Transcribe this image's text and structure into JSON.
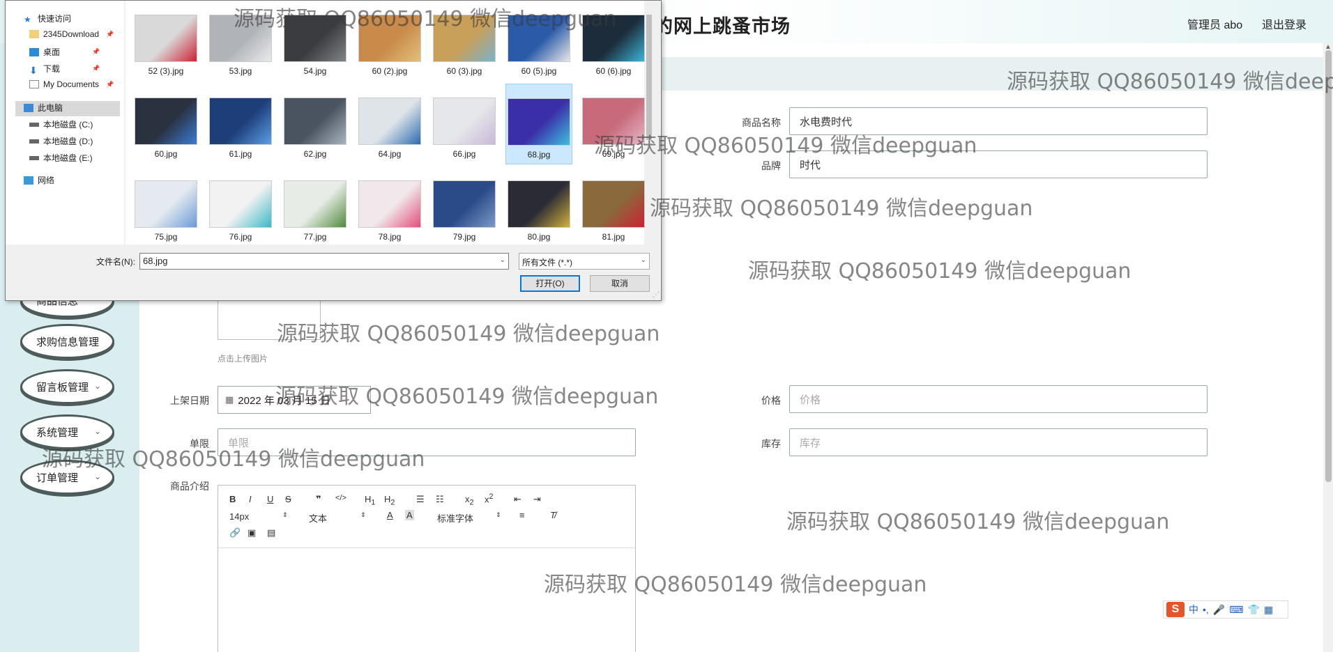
{
  "header": {
    "site_title": "的网上跳蚤市场",
    "admin_label": "管理员 abo",
    "logout_label": "退出登录"
  },
  "sidebar": {
    "items": [
      {
        "label": "商品信息",
        "has_chevron": false
      },
      {
        "label": "求购信息管理",
        "has_chevron": false
      },
      {
        "label": "留言板管理",
        "has_chevron": true
      },
      {
        "label": "系统管理",
        "has_chevron": true
      },
      {
        "label": "订单管理",
        "has_chevron": true
      }
    ]
  },
  "form": {
    "name_label": "商品名称",
    "name_value": "水电费时代",
    "brand_label": "品牌",
    "brand_value": "时代",
    "upload_hint": "点击上传图片",
    "date_label": "上架日期",
    "date_value": "2022 年 03 月 15 日",
    "price_label": "价格",
    "price_placeholder": "价格",
    "limit_label": "单限",
    "limit_placeholder": "单限",
    "stock_label": "库存",
    "stock_placeholder": "库存",
    "intro_label": "商品介绍"
  },
  "editor": {
    "font_size": "14px",
    "block_type": "文本",
    "font_family": "标准字体",
    "buttons": [
      "B",
      "I",
      "U",
      "S",
      "99",
      "</>",
      "H1",
      "H2",
      "list-ordered",
      "list-bullet",
      "x2-sub",
      "x2-sup",
      "outdent",
      "indent",
      "text-color",
      "bg-color",
      "align",
      "clear-format",
      "link",
      "image",
      "video"
    ]
  },
  "dialog": {
    "nav": [
      {
        "label": "快速访问",
        "icon": "star-icon",
        "pinned": false
      },
      {
        "label": "2345Download",
        "icon": "folder-icon",
        "pinned": true
      },
      {
        "label": "桌面",
        "icon": "desktop-icon",
        "pinned": true
      },
      {
        "label": "下载",
        "icon": "download-icon",
        "pinned": true
      },
      {
        "label": "My Documents",
        "icon": "document-icon",
        "pinned": true
      },
      {
        "label": "此电脑",
        "icon": "computer-icon",
        "pinned": false
      },
      {
        "label": "本地磁盘 (C:)",
        "icon": "drive-icon",
        "pinned": false
      },
      {
        "label": "本地磁盘 (D:)",
        "icon": "drive-icon",
        "pinned": false
      },
      {
        "label": "本地磁盘 (E:)",
        "icon": "drive-icon",
        "pinned": false
      },
      {
        "label": "网络",
        "icon": "network-icon",
        "pinned": false
      }
    ],
    "files": [
      {
        "name": "52 (3).jpg",
        "color": "#d9d9d9",
        "accent": "#c23"
      },
      {
        "name": "53.jpg",
        "color": "#b0b4b8",
        "accent": "#e9eaec"
      },
      {
        "name": "54.jpg",
        "color": "#3a3c40",
        "accent": "#808387"
      },
      {
        "name": "60 (2).jpg",
        "color": "#c98a4a",
        "accent": "#e2c07a"
      },
      {
        "name": "60 (3).jpg",
        "color": "#c9a05a",
        "accent": "#7ab3c9"
      },
      {
        "name": "60 (5).jpg",
        "color": "#2a5aa8",
        "accent": "#e8e8e8"
      },
      {
        "name": "60 (6).jpg",
        "color": "#1d2c3a",
        "accent": "#3ab6d8"
      },
      {
        "name": "60.jpg",
        "color": "#2a3240",
        "accent": "#3b7bd6"
      },
      {
        "name": "61.jpg",
        "color": "#1e3e7a",
        "accent": "#5aa0e8"
      },
      {
        "name": "62.jpg",
        "color": "#4a5460",
        "accent": "#a9b6c2"
      },
      {
        "name": "64.jpg",
        "color": "#dfe4e8",
        "accent": "#2e6bb0"
      },
      {
        "name": "66.jpg",
        "color": "#e6e7ea",
        "accent": "#c9b8d8"
      },
      {
        "name": "68.jpg",
        "color": "#3b2fa8",
        "accent": "#3cc0e0"
      },
      {
        "name": "69.jpg",
        "color": "#c86a7a",
        "accent": "#e3b8c8"
      },
      {
        "name": "75.jpg",
        "color": "#e4eaf0",
        "accent": "#6a9ad8"
      },
      {
        "name": "76.jpg",
        "color": "#f2f2f2",
        "accent": "#3ab8c8"
      },
      {
        "name": "77.jpg",
        "color": "#e8ece6",
        "accent": "#4f8a3c"
      },
      {
        "name": "78.jpg",
        "color": "#f0e8ea",
        "accent": "#e34e7a"
      },
      {
        "name": "79.jpg",
        "color": "#2a4a88",
        "accent": "#7a9ac8"
      },
      {
        "name": "80.jpg",
        "color": "#2b2b36",
        "accent": "#d4b13c"
      },
      {
        "name": "81.jpg",
        "color": "#8a6a3c",
        "accent": "#c23"
      }
    ],
    "selected_index": 12,
    "filename_label": "文件名(N):",
    "filename_value": "68.jpg",
    "filetype_value": "所有文件 (*.*)",
    "open_label": "打开(O)",
    "cancel_label": "取消"
  },
  "ime": {
    "logo": "S",
    "mode": "中"
  },
  "watermark": "源码获取 QQ86050149 微信deepguan"
}
